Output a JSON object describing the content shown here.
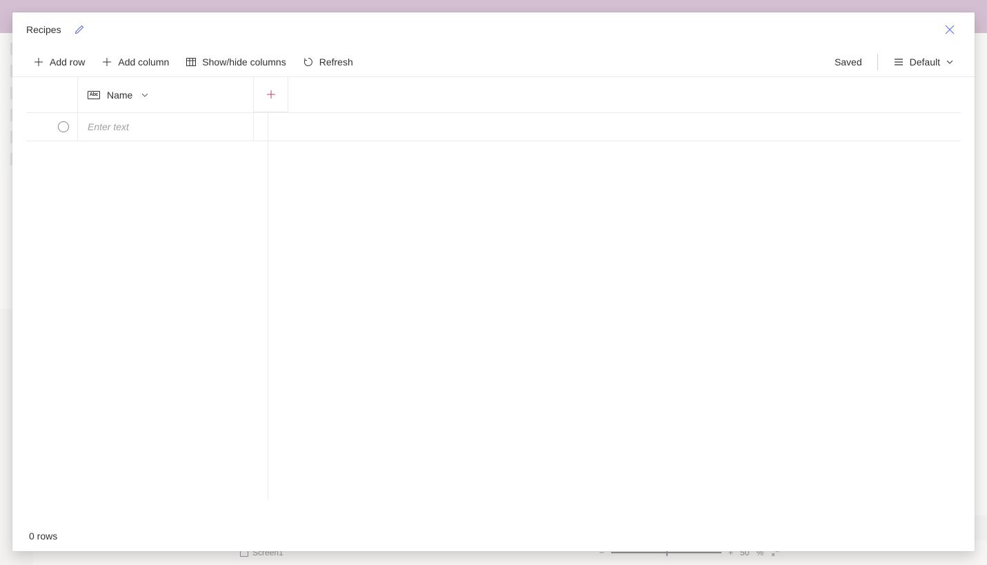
{
  "background": {
    "screen_label": "Screen1",
    "zoom_value": "50",
    "zoom_unit": "%"
  },
  "modal": {
    "title": "Recipes",
    "abc_badge": "Abc"
  },
  "toolbar": {
    "add_row": "Add row",
    "add_column": "Add column",
    "show_hide": "Show/hide columns",
    "refresh": "Refresh",
    "saved": "Saved",
    "view_label": "Default"
  },
  "columns": [
    {
      "label": "Name"
    }
  ],
  "rows": [
    {
      "value": "",
      "placeholder": "Enter text"
    }
  ],
  "status": {
    "row_count": "0 rows"
  }
}
